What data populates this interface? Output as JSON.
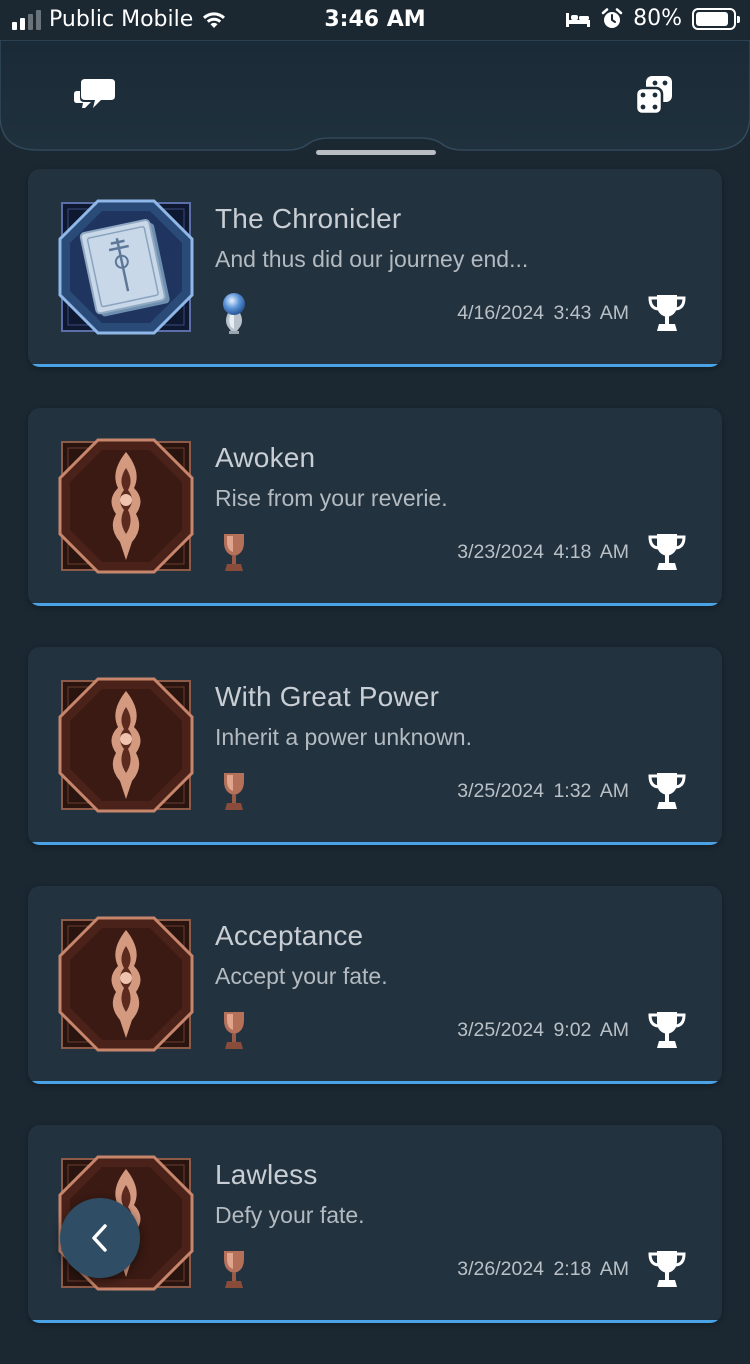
{
  "status_bar": {
    "carrier": "Public Mobile",
    "time": "3:46 AM",
    "battery": "80%"
  },
  "header": {
    "left_icon": "chat-bubbles-icon",
    "right_icon": "dice-icon"
  },
  "trophies": [
    {
      "title": "The Chronicler",
      "description": "And thus did our journey end...",
      "grade": "platinum",
      "date": "4/16/2024",
      "time": "3:43 AM",
      "art": "book"
    },
    {
      "title": "Awoken",
      "description": "Rise from your reverie.",
      "grade": "bronze",
      "date": "3/23/2024",
      "time": "4:18 AM",
      "art": "emblem"
    },
    {
      "title": "With Great Power",
      "description": "Inherit a power unknown.",
      "grade": "bronze",
      "date": "3/25/2024",
      "time": "1:32 AM",
      "art": "emblem"
    },
    {
      "title": "Acceptance",
      "description": "Accept your fate.",
      "grade": "bronze",
      "date": "3/25/2024",
      "time": "9:02 AM",
      "art": "emblem"
    },
    {
      "title": "Lawless",
      "description": "Defy your fate.",
      "grade": "bronze",
      "date": "3/26/2024",
      "time": "2:18 AM",
      "art": "emblem"
    }
  ],
  "colors": {
    "background": "#1b2731",
    "card": "#23323f",
    "accent": "#4aa3e6",
    "bronze": "#b5705a",
    "platinum": "#8fb8e8"
  }
}
